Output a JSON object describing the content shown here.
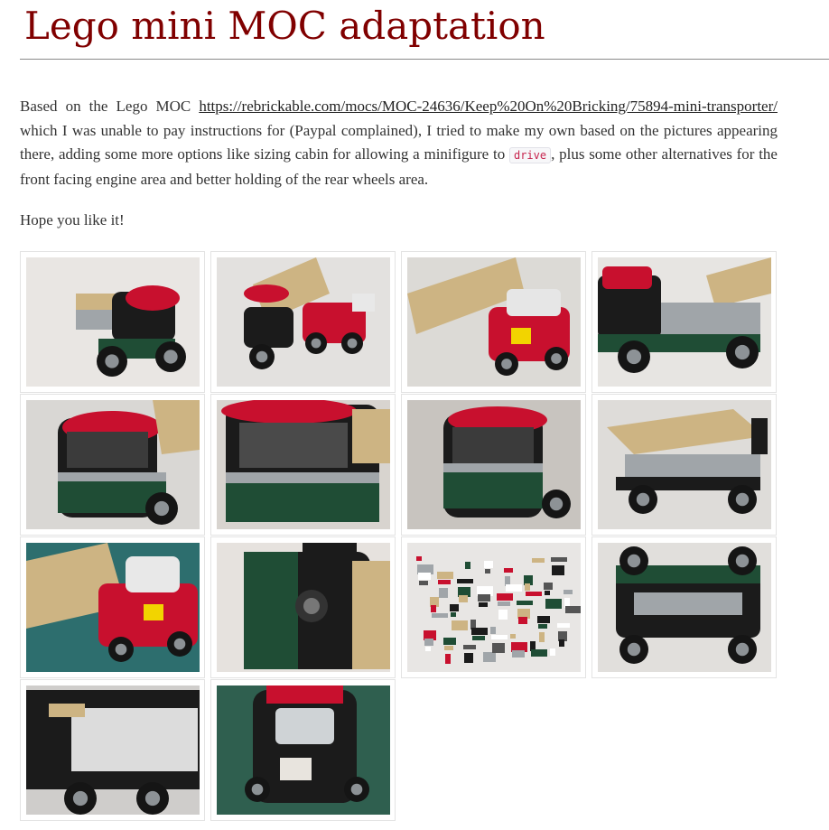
{
  "page": {
    "title": "Lego mini MOC adaptation",
    "intro": {
      "text_1": "Based on the Lego MOC ",
      "link": "https://rebrickable.com/mocs/MOC-24636/Keep%20On%20Bricking/75894-mini-transporter/",
      "text_2": " which I was unable to pay instructions for (Paypal complained), I tried to make my own based on the pictures appearing there, adding some more options like sizing cabin for allowing a minifigure to ",
      "code": "drive",
      "text_3": ", plus some other alternatives for the front facing engine area and better holding of the rear wheels area."
    },
    "closing": "Hope you like it!"
  },
  "colors": {
    "title": "#800000",
    "text": "#333333",
    "code": "#c7254e",
    "lego_red": "#c8102e",
    "lego_green": "#1f4d35",
    "lego_tan": "#cdb483",
    "lego_black": "#1b1b1b",
    "lego_grey": "#a0a5a9"
  },
  "gallery": [
    {
      "scene": "truck-side",
      "bg": "#e9e6e3"
    },
    {
      "scene": "truck-loading-car",
      "bg": "#e3e1df"
    },
    {
      "scene": "car-ramp",
      "bg": "#dcdad6"
    },
    {
      "scene": "truck-side-2",
      "bg": "#e7e5e2"
    },
    {
      "scene": "cab-front",
      "bg": "#d9d7d4"
    },
    {
      "scene": "cab-closeup",
      "bg": "#d8d4cf"
    },
    {
      "scene": "cab-front-2",
      "bg": "#c8c4bf"
    },
    {
      "scene": "flatbed-empty",
      "bg": "#dedcd9"
    },
    {
      "scene": "mini-car-mat",
      "bg": "#2d6e6e"
    },
    {
      "scene": "cab-top",
      "bg": "#e6e2de"
    },
    {
      "scene": "parts-pile",
      "bg": "#e8e6e4"
    },
    {
      "scene": "chassis-underside",
      "bg": "#e1dfdc"
    },
    {
      "scene": "chassis-underside-2",
      "bg": "#cfcdcb"
    },
    {
      "scene": "cab-front-mat",
      "bg": "#2f5f4f"
    }
  ]
}
